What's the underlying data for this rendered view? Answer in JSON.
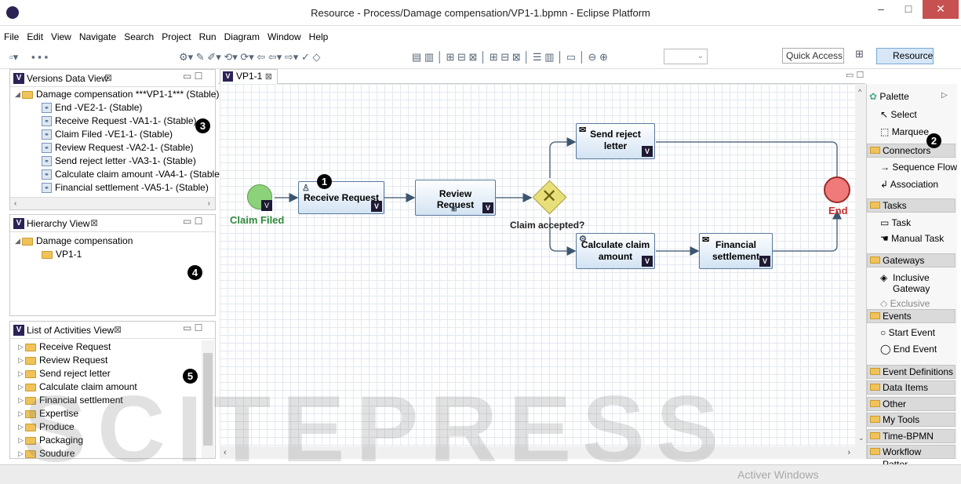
{
  "window": {
    "title": "Resource - Process/Damage compensation/VP1-1.bpmn - Eclipse Platform",
    "minimize_label": "–",
    "maximize_label": "□",
    "close_label": "✕"
  },
  "menu": {
    "items": [
      "File",
      "Edit",
      "View",
      "Navigate",
      "Search",
      "Project",
      "Run",
      "Diagram",
      "Window",
      "Help"
    ]
  },
  "toolbar": {
    "quick_access": "Quick Access",
    "perspective": "Resource"
  },
  "versions_view": {
    "title": "Versions Data View",
    "root": "Damage compensation ***VP1-1*** (Stable)",
    "items": [
      "End -VE2-1-  (Stable)",
      "Receive Request -VA1-1-  (Stable)",
      "Claim Filed -VE1-1-  (Stable)",
      "Review Request -VA2-1-  (Stable)",
      "Send reject letter -VA3-1-  (Stable)",
      "Calculate claim amount -VA4-1-  (Stable)",
      "Financial settlement -VA5-1-  (Stable)"
    ],
    "marker": "3"
  },
  "hierarchy_view": {
    "title": "Hierarchy View",
    "root": "Damage compensation",
    "child": "VP1-1",
    "marker": "4"
  },
  "activities_view": {
    "title": "List of Activities View",
    "items": [
      "Receive Request",
      "Review Request",
      "Send reject letter",
      "Calculate claim amount",
      "Financial settlement",
      "Expertise",
      "Produce",
      "Packaging",
      "Soudure"
    ],
    "marker": "5"
  },
  "editor": {
    "tab": "VP1-1",
    "start_event": "Claim Filed",
    "end_event": "End",
    "gateway_label": "Claim accepted?",
    "tasks": {
      "receive": "Receive Request",
      "review": "Review Request",
      "reject": "Send reject letter",
      "calculate": "Calculate claim amount",
      "financial": "Financial settlement"
    },
    "marker": "1"
  },
  "palette": {
    "title": "Palette",
    "select": "Select",
    "marquee": "Marquee",
    "connectors": "Connectors",
    "sequence_flow": "Sequence Flow",
    "association": "Association",
    "tasks": "Tasks",
    "task": "Task",
    "manual_task": "Manual Task",
    "gateways": "Gateways",
    "inclusive_gateway": "Inclusive Gateway",
    "exclusive": "Exclusive",
    "events": "Events",
    "start_event": "Start Event",
    "end_event": "End Event",
    "categories": [
      "Event Definitions",
      "Data Items",
      "Other",
      "My Tools",
      "Time-BPMN",
      "Workflow Patter..."
    ],
    "marker": "2"
  },
  "watermark": {
    "text": "SCITEPRESS",
    "activate": "Activer Windows"
  },
  "colors": {
    "start": "#8cd27a",
    "end": "#f07a7a",
    "gateway": "#e8df7a",
    "start_label": "#2f8a3a",
    "end_label": "#c23030"
  }
}
